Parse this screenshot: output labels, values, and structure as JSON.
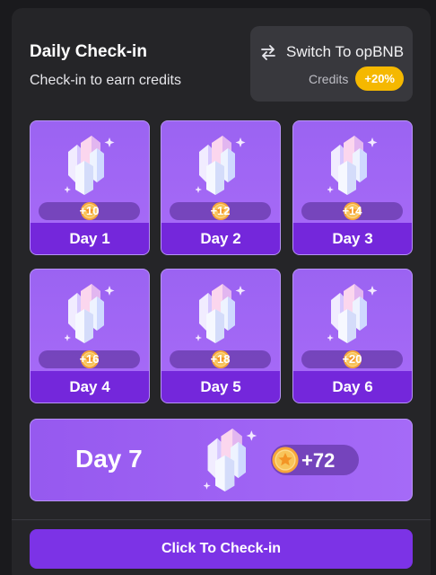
{
  "header": {
    "title": "Daily Check-in",
    "subtitle": "Check-in to earn credits"
  },
  "switch": {
    "label": "Switch To opBNB",
    "credits_label": "Credits",
    "credits_bonus": "+20%",
    "icon": "swap-arrows-icon"
  },
  "days": [
    {
      "label": "Day 1",
      "reward": "+10"
    },
    {
      "label": "Day 2",
      "reward": "+12"
    },
    {
      "label": "Day 3",
      "reward": "+14"
    },
    {
      "label": "Day 4",
      "reward": "+16"
    },
    {
      "label": "Day 5",
      "reward": "+18"
    },
    {
      "label": "Day 6",
      "reward": "+20"
    }
  ],
  "day7": {
    "label": "Day 7",
    "reward": "+72"
  },
  "checkin_button": {
    "label": "Click To Check-in"
  },
  "colors": {
    "background": "#1a1a1d",
    "panel": "#252528",
    "card": "#a06af5",
    "card_footer": "#7427db",
    "button": "#7c33e6",
    "badge": "#f5b800"
  }
}
